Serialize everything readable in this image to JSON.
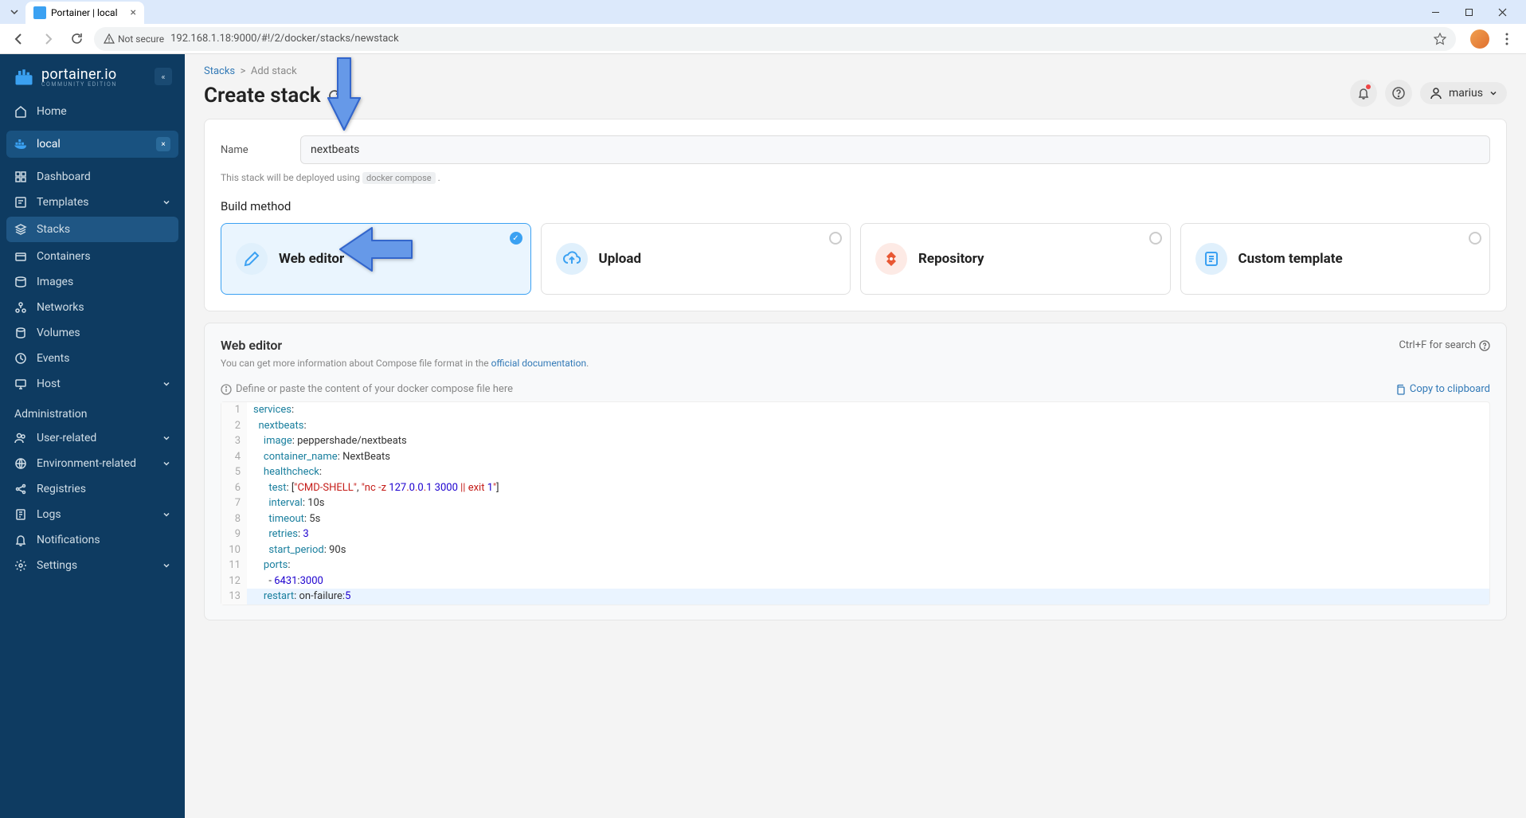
{
  "browser": {
    "tab_title": "Portainer | local",
    "url": "192.168.1.18:9000/#!/2/docker/stacks/newstack",
    "security_label": "Not secure"
  },
  "sidebar": {
    "logo": {
      "name": "portainer.io",
      "edition": "COMMUNITY EDITION"
    },
    "home": "Home",
    "env_name": "local",
    "items": [
      {
        "icon": "dashboard",
        "label": "Dashboard"
      },
      {
        "icon": "templates",
        "label": "Templates",
        "chev": true
      },
      {
        "icon": "stacks",
        "label": "Stacks",
        "active": true
      },
      {
        "icon": "containers",
        "label": "Containers"
      },
      {
        "icon": "images",
        "label": "Images"
      },
      {
        "icon": "networks",
        "label": "Networks"
      },
      {
        "icon": "volumes",
        "label": "Volumes"
      },
      {
        "icon": "events",
        "label": "Events"
      },
      {
        "icon": "host",
        "label": "Host",
        "chev": true
      }
    ],
    "admin_title": "Administration",
    "admin_items": [
      {
        "icon": "users",
        "label": "User-related",
        "chev": true
      },
      {
        "icon": "env",
        "label": "Environment-related",
        "chev": true
      },
      {
        "icon": "registries",
        "label": "Registries"
      },
      {
        "icon": "logs",
        "label": "Logs",
        "chev": true
      },
      {
        "icon": "notifications",
        "label": "Notifications"
      },
      {
        "icon": "settings",
        "label": "Settings",
        "chev": true
      }
    ]
  },
  "header": {
    "breadcrumb_root": "Stacks",
    "breadcrumb_current": "Add stack",
    "page_title": "Create stack",
    "username": "marius"
  },
  "form": {
    "name_label": "Name",
    "name_value": "nextbeats",
    "deploy_hint_pre": "This stack will be deployed using",
    "deploy_hint_code": "docker compose",
    "build_method_label": "Build method",
    "methods": [
      {
        "id": "web-editor",
        "title": "Web editor",
        "selected": true,
        "icon_color": "blue"
      },
      {
        "id": "upload",
        "title": "Upload",
        "selected": false,
        "icon_color": "blue"
      },
      {
        "id": "repository",
        "title": "Repository",
        "selected": false,
        "icon_color": "red"
      },
      {
        "id": "custom-template",
        "title": "Custom template",
        "selected": false,
        "icon_color": "blue"
      }
    ]
  },
  "editor": {
    "title": "Web editor",
    "search_hint": "Ctrl+F for search",
    "desc_pre": "You can get more information about Compose file format in the ",
    "desc_link": "official documentation",
    "compose_hint": "Define or paste the content of your docker compose file here",
    "copy_label": "Copy to clipboard",
    "lines": [
      {
        "n": 1,
        "raw": "services:"
      },
      {
        "n": 2,
        "raw": "  nextbeats:"
      },
      {
        "n": 3,
        "raw": "    image: peppershade/nextbeats"
      },
      {
        "n": 4,
        "raw": "    container_name: NextBeats"
      },
      {
        "n": 5,
        "raw": "    healthcheck:"
      },
      {
        "n": 6,
        "raw": "      test: [\"CMD-SHELL\", \"nc -z 127.0.0.1 3000 || exit 1\"]"
      },
      {
        "n": 7,
        "raw": "      interval: 10s"
      },
      {
        "n": 8,
        "raw": "      timeout: 5s"
      },
      {
        "n": 9,
        "raw": "      retries: 3"
      },
      {
        "n": 10,
        "raw": "      start_period: 90s"
      },
      {
        "n": 11,
        "raw": "    ports:"
      },
      {
        "n": 12,
        "raw": "      - 6431:3000"
      },
      {
        "n": 13,
        "raw": "    restart: on-failure:5"
      }
    ]
  }
}
